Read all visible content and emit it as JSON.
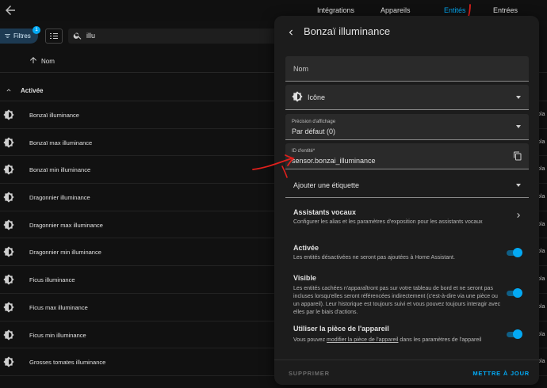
{
  "topbar": {
    "tabs": [
      {
        "label": "Intégrations"
      },
      {
        "label": "Appareils"
      },
      {
        "label": "Entités"
      },
      {
        "label": "Entrées"
      }
    ]
  },
  "toolbar": {
    "filter_label": "Filtres",
    "filter_count": "1",
    "search_value": "illu"
  },
  "table": {
    "column_name": "Nom",
    "group_label": "Activée",
    "rows": [
      {
        "label": "Bonzaï illuminance"
      },
      {
        "label": "Bonzaï max illuminance"
      },
      {
        "label": "Bonzaï min illuminance"
      },
      {
        "label": "Dragonnier illuminance"
      },
      {
        "label": "Dragonnier max illuminance"
      },
      {
        "label": "Dragonnier min illuminance"
      },
      {
        "label": "Ficus illuminance"
      },
      {
        "label": "Ficus max illuminance"
      },
      {
        "label": "Ficus min illuminance"
      },
      {
        "label": "Grosses tomates illuminance"
      }
    ],
    "right_cut_text": "pla"
  },
  "dialog": {
    "title": "Bonzaï illuminance",
    "name_placeholder": "Nom",
    "icon_label": "Icône",
    "precision_label": "Précision d'affichage",
    "precision_value": "Par défaut (0)",
    "entity_id_label": "ID d'entité*",
    "entity_id_value": "sensor.bonzai_illuminance",
    "label_placeholder": "Ajouter une étiquette",
    "voice": {
      "title": "Assistants vocaux",
      "desc": "Configurer les alias et les paramètres d'exposition pour les assistants vocaux"
    },
    "enabled": {
      "title": "Activée",
      "desc": "Les entités désactivées ne seront pas ajoutées à Home Assistant.",
      "on": true
    },
    "visible": {
      "title": "Visible",
      "desc": "Les entités cachées n'apparaîtront pas sur votre tableau de bord et ne seront pas incluses lorsqu'elles seront référencées indirectement (c'est-à-dire via une pièce ou un appareil). Leur historique est toujours suivi et vous pouvez toujours interagir avec elles par le biais d'actions.",
      "on": true
    },
    "device_area": {
      "title": "Utiliser la pièce de l'appareil",
      "desc_prefix": "Vous pouvez ",
      "desc_link": "modifier la pièce de l'appareil",
      "desc_suffix": " dans les paramètres de l'appareil",
      "on": true
    },
    "delete_label": "SUPPRIMER",
    "update_label": "METTRE À JOUR"
  },
  "colors": {
    "accent": "#03a9f4",
    "background": "#111111",
    "dialog": "#1c1c1c",
    "annotation": "#e0201c"
  }
}
